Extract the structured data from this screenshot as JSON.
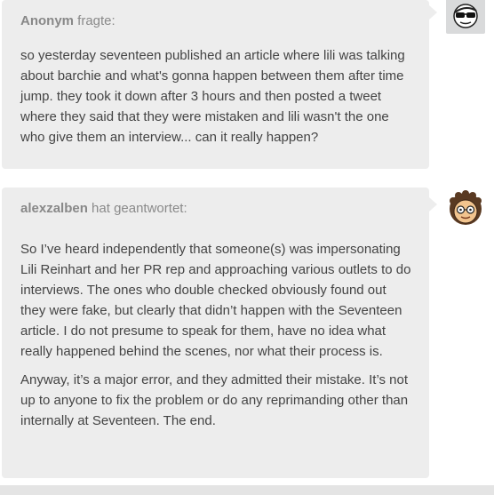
{
  "question": {
    "author": "Anonym",
    "verb": "fragte:",
    "text": "so yesterday seventeen published an article where lili was talking about barchie and what's gonna happen between them after time jump. they took it down after 3 hours and then posted a tweet where they said that they were mistaken and lili wasn't the one who give them an interview... can it really happen?",
    "avatar_icon": "sunglasses-face-icon"
  },
  "answer": {
    "author": "alexzalben",
    "verb": "hat geantwortet:",
    "paragraphs": [
      "So I’ve heard independently that someone(s) was impersonating Lili Reinhart and her PR rep and approaching various outlets to do interviews. The ones who double checked obviously found out they were fake, but clearly that didn’t happen with the Seventeen article. I do not presume to speak for them, have no idea what really happened behind the scenes, nor what their process is.",
      "Anyway, it’s a major error, and they admitted their mistake. It’s not up to anyone to fix the problem or do any reprimanding other than internally at Seventeen. The end."
    ],
    "avatar_icon": "cartoon-face-with-glasses-icon"
  },
  "colors": {
    "bubble": "#ededed",
    "text": "#444444",
    "meta": "#888888"
  }
}
